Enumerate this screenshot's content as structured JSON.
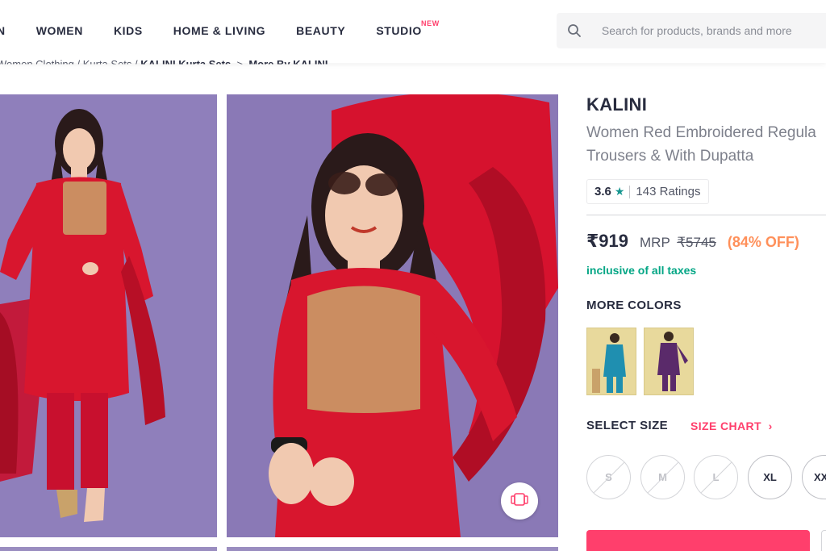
{
  "header": {
    "nav": [
      {
        "label": "N"
      },
      {
        "label": "WOMEN"
      },
      {
        "label": "KIDS"
      },
      {
        "label": "HOME & LIVING"
      },
      {
        "label": "BEAUTY"
      },
      {
        "label": "STUDIO",
        "badge": "NEW"
      }
    ],
    "search_placeholder": "Search for products, brands and more"
  },
  "breadcrumb": {
    "items": [
      "Women Clothing",
      "Kurta Sets",
      "KALINI Kurta Sets"
    ],
    "current": "More By KALINI"
  },
  "product": {
    "brand": "KALINI",
    "name_line1": "Women Red Embroidered Regula",
    "name_line2": "Trousers & With Dupatta",
    "rating": "3.6",
    "rating_icon": "star-icon",
    "ratings_count": "143 Ratings",
    "price": "₹919",
    "mrp_label": "MRP",
    "mrp": "₹5745",
    "discount": "(84% OFF)",
    "tax_note": "inclusive of all taxes",
    "more_colors_label": "MORE COLORS",
    "select_size_label": "SELECT SIZE",
    "size_chart_label": "SIZE CHART",
    "sizes": [
      {
        "label": "S",
        "available": false
      },
      {
        "label": "M",
        "available": false
      },
      {
        "label": "L",
        "available": false
      },
      {
        "label": "XL",
        "available": true
      },
      {
        "label": "XX",
        "available": true
      }
    ]
  },
  "colors": {
    "accent": "#ff3f6c",
    "discount": "#ff905a",
    "tax": "#03a685",
    "rating_star": "#14958f"
  }
}
